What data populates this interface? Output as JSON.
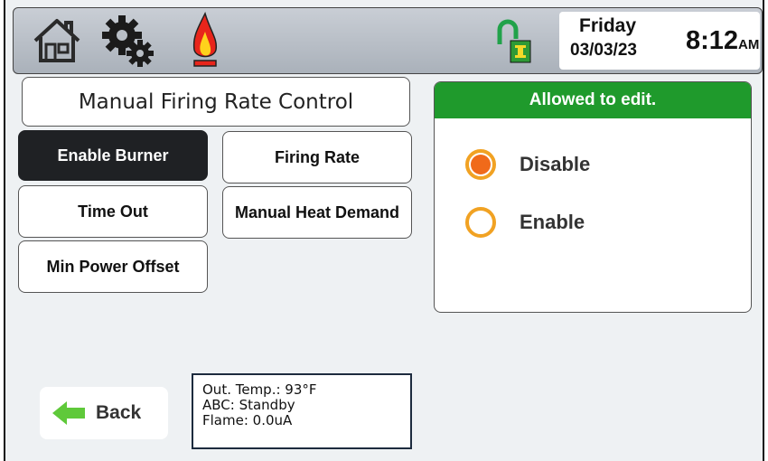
{
  "header": {
    "icons": [
      "home-icon",
      "gear-icon",
      "flame-icon",
      "connection-status-icon"
    ],
    "day": "Friday",
    "date": "03/03/23",
    "time": "8:12",
    "ampm": "AM"
  },
  "screen_title": "Manual Firing Rate Control",
  "menu": {
    "enable_burner": "Enable Burner",
    "firing_rate": "Firing Rate",
    "time_out": "Time Out",
    "manual_heat_demand": "Manual Heat Demand",
    "min_power_offset": "Min Power Offset"
  },
  "panel": {
    "header": "Allowed to edit.",
    "options": [
      "Disable",
      "Enable"
    ],
    "selected": "Disable"
  },
  "back_label": "Back",
  "status": {
    "out_temp": "Out. Temp.: 93°F",
    "abc": "ABC: Standby",
    "flame": "Flame: 0.0uA"
  },
  "colors": {
    "header_green": "#1f9a2c",
    "radio_orange": "#f1a223",
    "radio_fill": "#f06a1a",
    "active_button": "#1f2124"
  }
}
